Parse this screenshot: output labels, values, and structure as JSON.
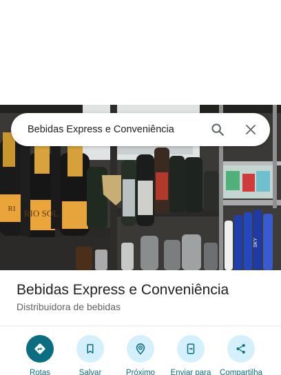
{
  "search": {
    "query": "Bebidas Express e Conveniência",
    "search_icon": "search-icon",
    "close_icon": "close-icon"
  },
  "place": {
    "name": "Bebidas Express e Conveniência",
    "category": "Distribuidora de bebidas"
  },
  "photo": {
    "label_main": "RIO SOL",
    "bottle_label": "SKY"
  },
  "actions": [
    {
      "label": "Rotas",
      "icon": "directions-icon"
    },
    {
      "label": "Salvar",
      "icon": "bookmark-icon"
    },
    {
      "label": "Próximo",
      "icon": "nearby-icon"
    },
    {
      "label": "Enviar para",
      "icon": "send-to-phone-icon"
    },
    {
      "label": "Compartilha",
      "icon": "share-icon"
    }
  ],
  "colors": {
    "accent": "#0b6e80",
    "action_bg": "#d5f0fd",
    "text_primary": "#202124",
    "text_secondary": "#5f6368"
  }
}
